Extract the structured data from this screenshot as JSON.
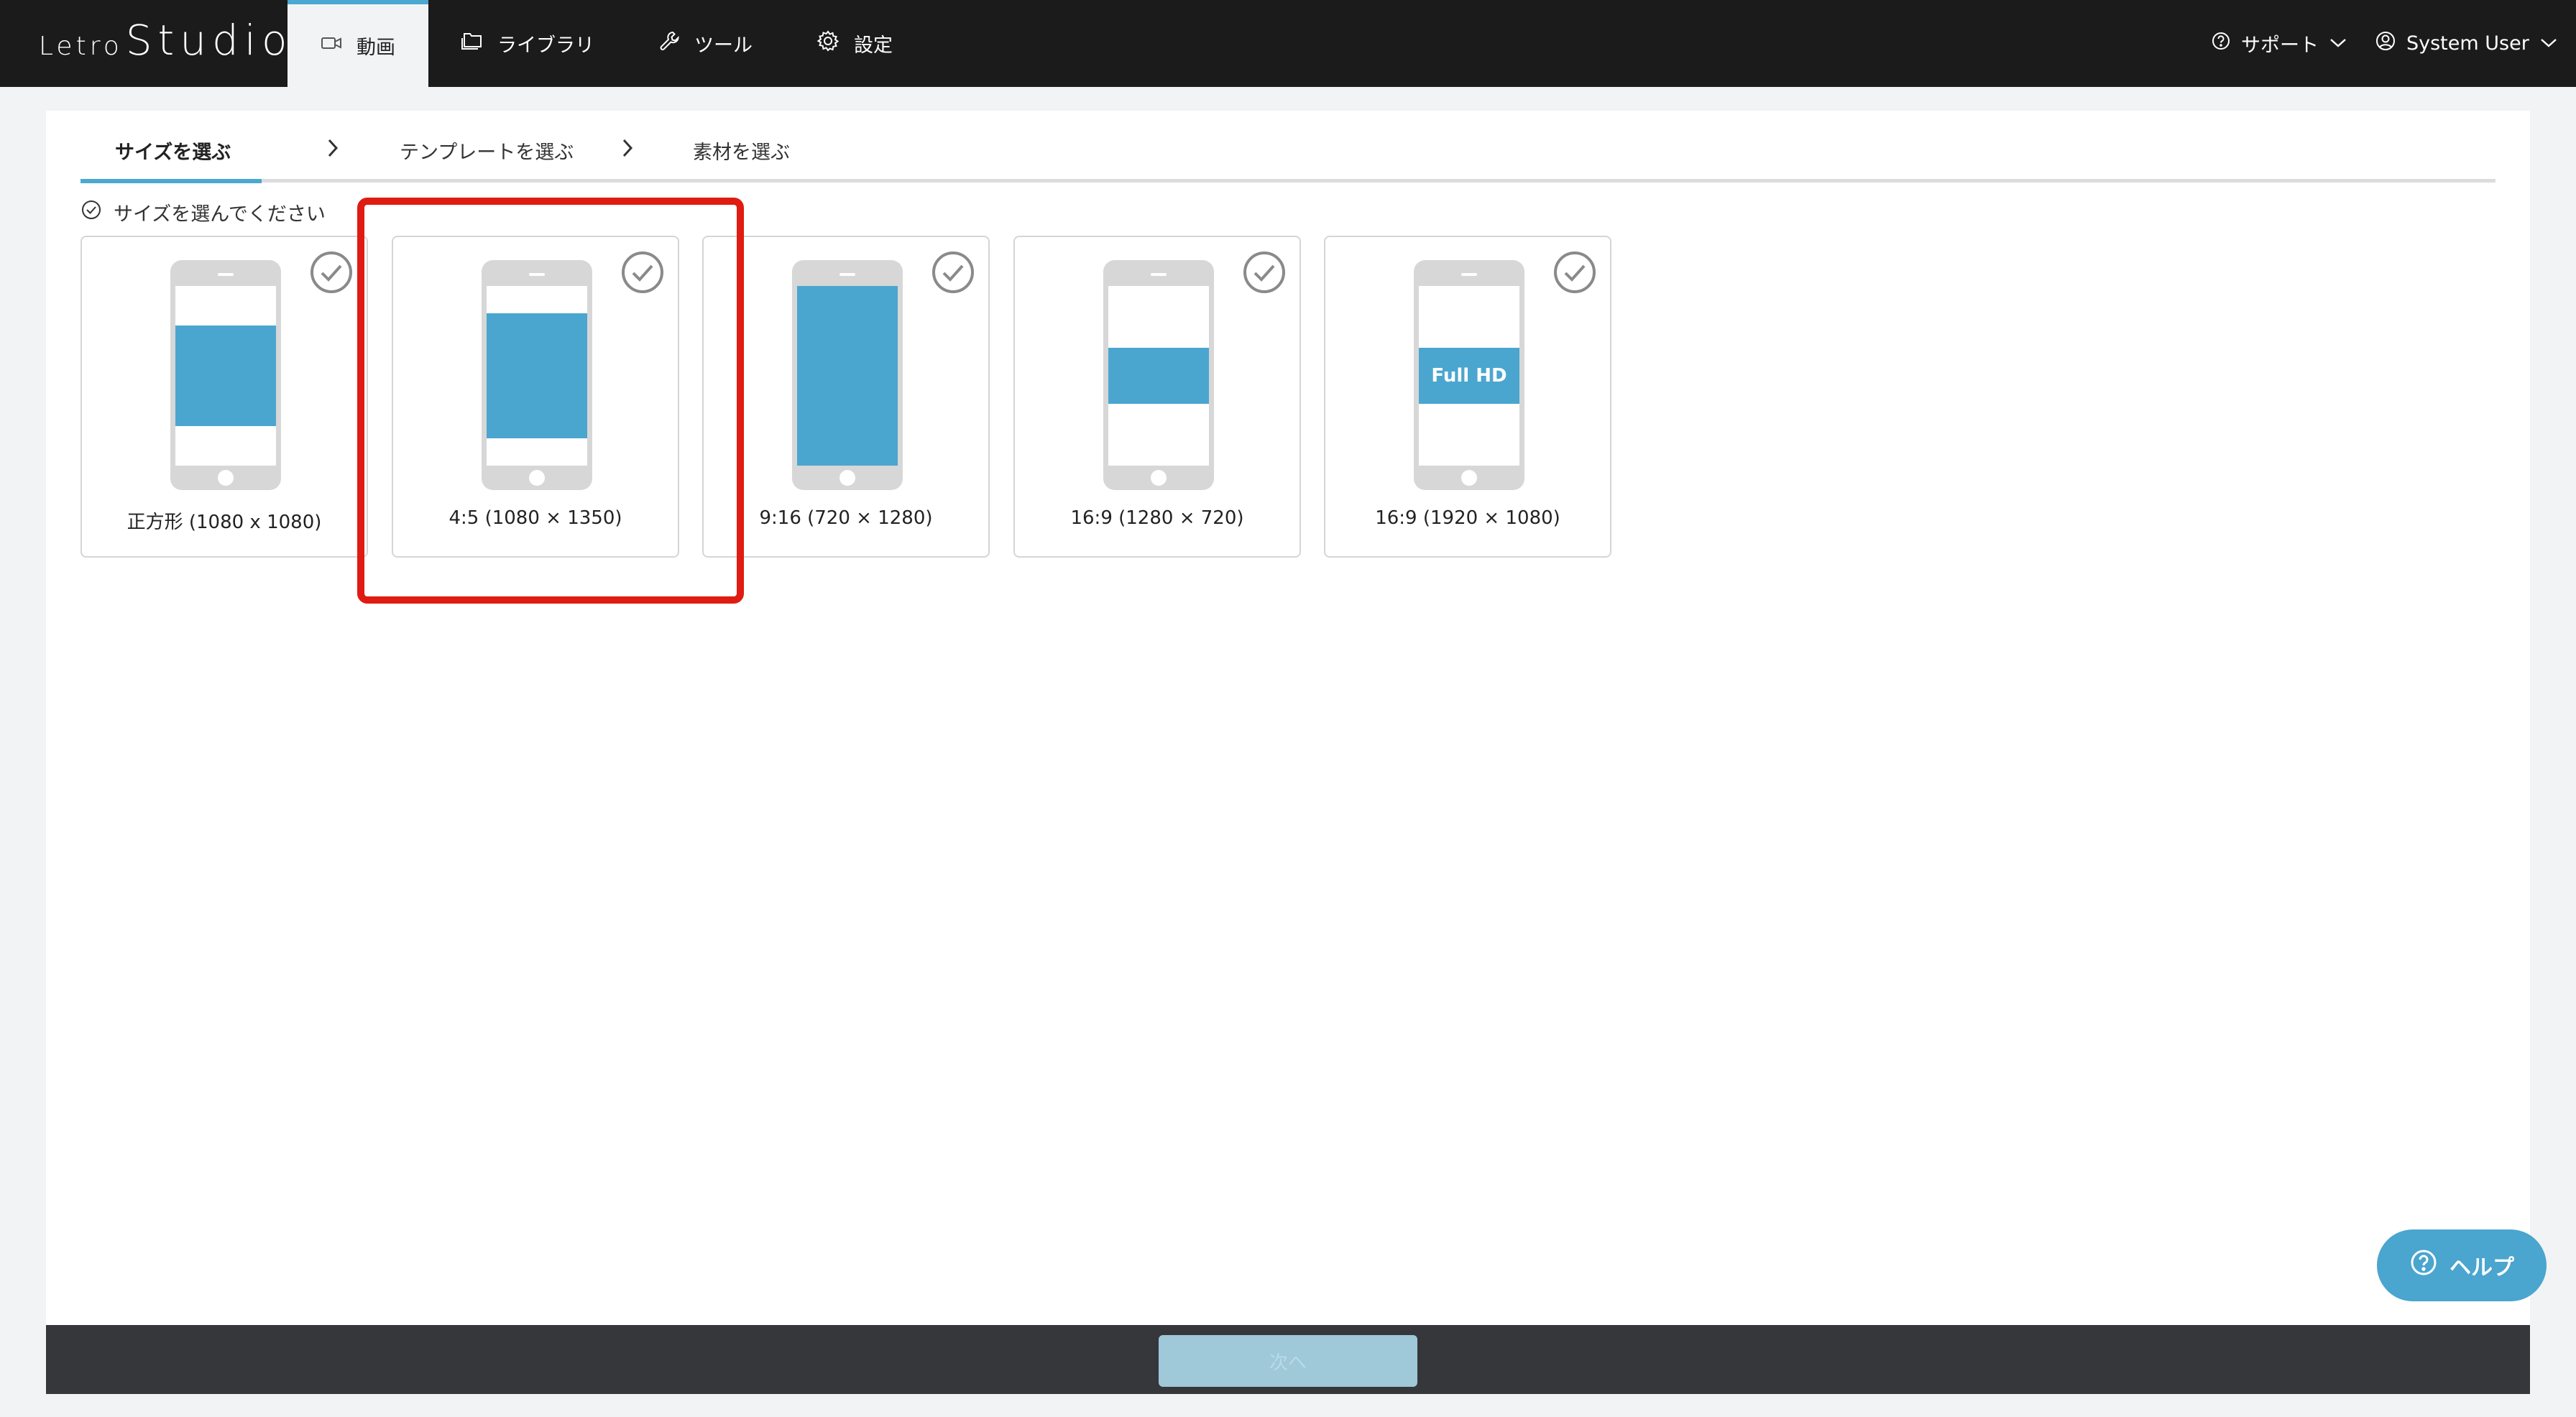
{
  "app": {
    "logo_small": "Letro",
    "logo_big": "Studio"
  },
  "nav": {
    "tabs": [
      {
        "label": "動画",
        "icon": "video-camera-icon",
        "active": true
      },
      {
        "label": "ライブラリ",
        "icon": "folder-icon",
        "active": false
      },
      {
        "label": "ツール",
        "icon": "wrench-icon",
        "active": false
      },
      {
        "label": "設定",
        "icon": "gear-icon",
        "active": false
      }
    ],
    "support_label": "サポート",
    "user_label": "System User"
  },
  "steps": [
    {
      "label": "サイズを選ぶ",
      "active": true
    },
    {
      "label": "テンプレートを選ぶ",
      "active": false
    },
    {
      "label": "素材を選ぶ",
      "active": false
    }
  ],
  "instruction": "サイズを選んでください",
  "sizes": [
    {
      "label": "正方形 (1080 x 1080)",
      "aspect": "1:1",
      "badge": ""
    },
    {
      "label": "4:5 (1080 × 1350)",
      "aspect": "4:5",
      "badge": ""
    },
    {
      "label": "9:16 (720 × 1280)",
      "aspect": "9:16",
      "badge": ""
    },
    {
      "label": "16:9 (1280 × 720)",
      "aspect": "16:9",
      "badge": ""
    },
    {
      "label": "16:9 (1920 × 1080)",
      "aspect": "16:9",
      "badge": "Full HD"
    }
  ],
  "footer": {
    "next_label": "次へ",
    "next_disabled": true
  },
  "help": {
    "label": "ヘルプ"
  },
  "colors": {
    "accent": "#4ba8d1",
    "media_blue": "#4aa6cf",
    "highlight_red": "#e01b12",
    "topbar": "#1b1b1b"
  }
}
